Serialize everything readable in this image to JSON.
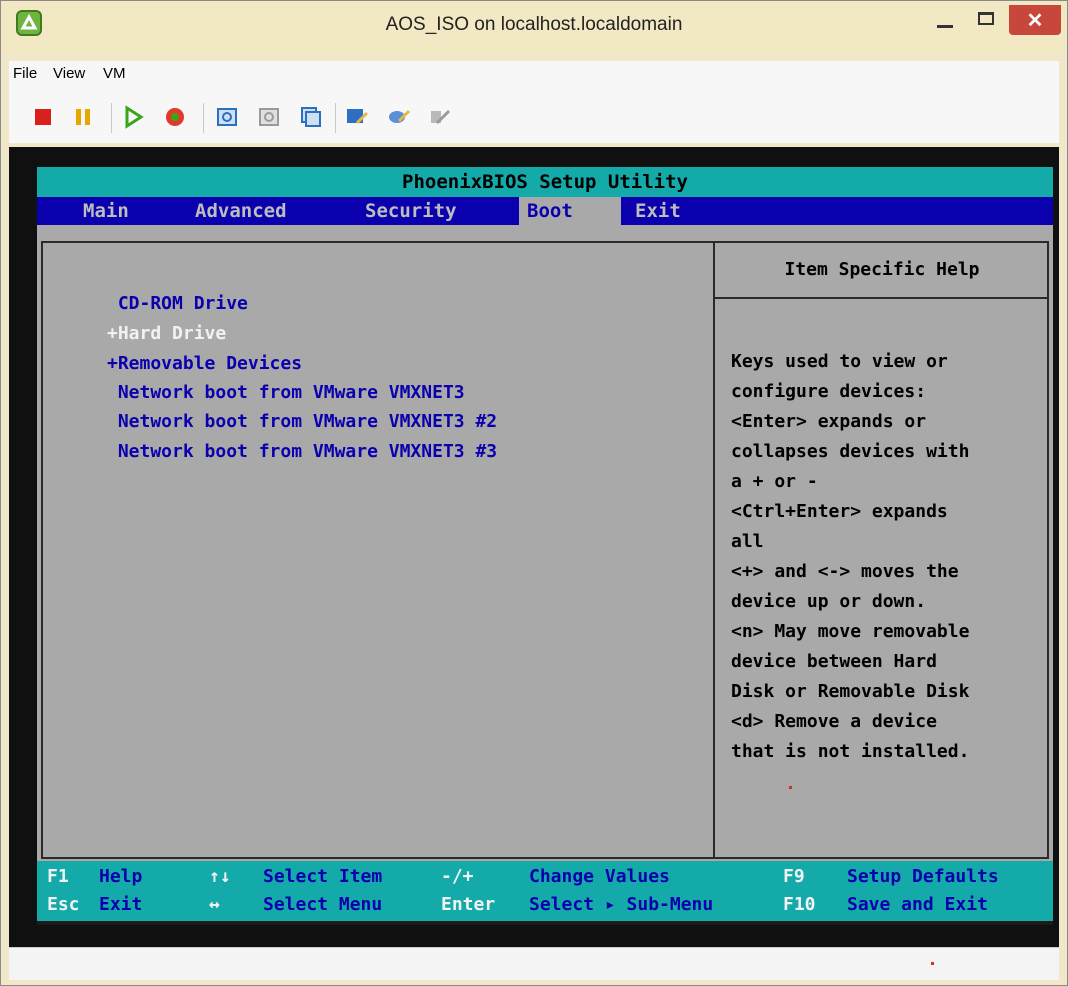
{
  "window": {
    "title": "AOS_ISO on localhost.localdomain",
    "close_symbol": "✕"
  },
  "menubar": {
    "items": [
      "File",
      "View",
      "VM"
    ]
  },
  "toolbar": {
    "buttons": [
      {
        "icon": "stop-icon",
        "color": "#d9201c"
      },
      {
        "icon": "pause-icon",
        "color": "#e5a800"
      },
      {
        "icon": "play-icon",
        "color": "#3aa51c"
      },
      {
        "icon": "reset-icon",
        "color": "#e03b2a"
      },
      {
        "icon": "snapshot-icon",
        "color": "#2d6fc0"
      },
      {
        "icon": "revert-snapshot-icon",
        "color": "#9a9a9a"
      },
      {
        "icon": "manage-snapshots-icon",
        "color": "#2d6fc0"
      },
      {
        "icon": "connect-devices-icon",
        "color": "#2d6fc0"
      },
      {
        "icon": "send-ctrl-alt-del-icon",
        "color": "#5b8fd6"
      },
      {
        "icon": "disconnect-devices-icon",
        "color": "#9a9a9a"
      }
    ]
  },
  "bios": {
    "title": "PhoenixBIOS Setup Utility",
    "tabs": [
      "Main",
      "Advanced",
      "Security",
      "Boot",
      "Exit"
    ],
    "active_tab": "Boot",
    "boot_items": [
      " CD-ROM Drive",
      "+Hard Drive",
      "+Removable Devices",
      " Network boot from VMware VMXNET3",
      " Network boot from VMware VMXNET3 #2",
      " Network boot from VMware VMXNET3 #3"
    ],
    "selected_item": "+Hard Drive",
    "help_title": "Item Specific Help",
    "help_lines": [
      "Keys used to view or",
      "configure devices:",
      "<Enter> expands or",
      "collapses devices with",
      "a + or -",
      "<Ctrl+Enter> expands",
      "all",
      "<+> and <-> moves the",
      "device up or down.",
      "<n> May move removable",
      "device between Hard",
      "Disk or Removable Disk",
      "<d> Remove a device",
      "that is not installed."
    ],
    "footer": {
      "row1": [
        {
          "key": "F1",
          "desc": "Help"
        },
        {
          "key": "↑↓",
          "desc": "Select Item"
        },
        {
          "key": "-/+",
          "desc": "Change Values"
        },
        {
          "key": "F9",
          "desc": "Setup Defaults"
        }
      ],
      "row2": [
        {
          "key": "Esc",
          "desc": "Exit"
        },
        {
          "key": "↔",
          "desc": "Select Menu"
        },
        {
          "key": "Enter",
          "desc": "Select ▸ Sub-Menu"
        },
        {
          "key": "F10",
          "desc": "Save and Exit"
        }
      ]
    },
    "colors": {
      "title_bar": "#14aaaa",
      "tab_bar": "#0b00ad",
      "body": "#a9a9a9",
      "item_text": "#0b00ad",
      "selected_text": "#f2f2f2"
    }
  }
}
